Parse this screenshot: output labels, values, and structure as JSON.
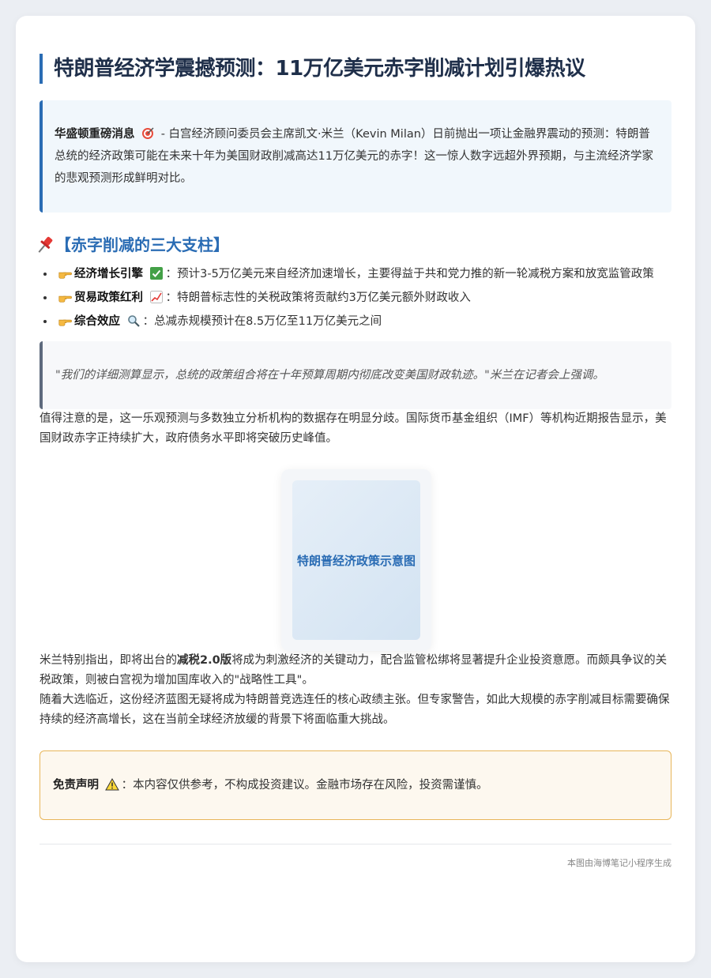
{
  "title": "特朗普经济学震撼预测：11万亿美元赤字削减计划引爆热议",
  "intro": {
    "lead": "华盛顿重磅消息",
    "lead_icon": "target-icon",
    "text": " - 白宫经济顾问委员会主席凯文·米兰（Kevin Milan）日前抛出一项让金融界震动的预测：特朗普总统的经济政策可能在未来十年为美国财政削减高达11万亿美元的赤字！这一惊人数字远超外界预期，与主流经济学家的悲观预测形成鲜明对比。"
  },
  "section": {
    "icon": "pushpin-icon",
    "heading": "【赤字削减的三大支柱】"
  },
  "pillars": [
    {
      "icon": "pointing-hand-icon",
      "title": "经济增长引擎",
      "badge_icon": "check-mark-icon",
      "text": "：预计3-5万亿美元来自经济加速增长，主要得益于共和党力推的新一轮减税方案和放宽监管政策"
    },
    {
      "icon": "pointing-hand-icon",
      "title": "贸易政策红利",
      "badge_icon": "chart-increasing-icon",
      "text": "：特朗普标志性的关税政策将贡献约3万亿美元额外财政收入"
    },
    {
      "icon": "pointing-hand-icon",
      "title": "综合效应",
      "badge_icon": "magnifier-icon",
      "text": "：总减赤规模预计在8.5万亿至11万亿美元之间"
    }
  ],
  "quote": "\"我们的详细测算显示，总统的政策组合将在十年预算周期内彻底改变美国财政轨迹。\"米兰在记者会上强调。",
  "paragraph1": "值得注意的是，这一乐观预测与多数独立分析机构的数据存在明显分歧。国际货币基金组织（IMF）等机构近期报告显示，美国财政赤字正持续扩大，政府债务水平即将突破历史峰值。",
  "figure_label": "特朗普经济政策示意图",
  "paragraph2": {
    "before": "米兰特别指出，即将出台的",
    "bold": "减税2.0版",
    "after": "将成为刺激经济的关键动力，配合监管松绑将显著提升企业投资意愿。而颇具争议的关税政策，则被白宫视为增加国库收入的\"战略性工具\"。"
  },
  "paragraph3": "随着大选临近，这份经济蓝图无疑将成为特朗普竞选连任的核心政绩主张。但专家警告，如此大规模的赤字削减目标需要确保持续的经济高增长，这在当前全球经济放缓的背景下将面临重大挑战。",
  "disclaimer": {
    "label": "免责声明",
    "icon": "warning-icon",
    "text": "：本内容仅供参考，不构成投资建议。金融市场存在风险，投资需谨慎。"
  },
  "footer": "本图由海博笔记小程序生成",
  "colors": {
    "accent": "#2a6cb4",
    "title": "#1f2f4a",
    "warning_border": "#e8b65a"
  }
}
